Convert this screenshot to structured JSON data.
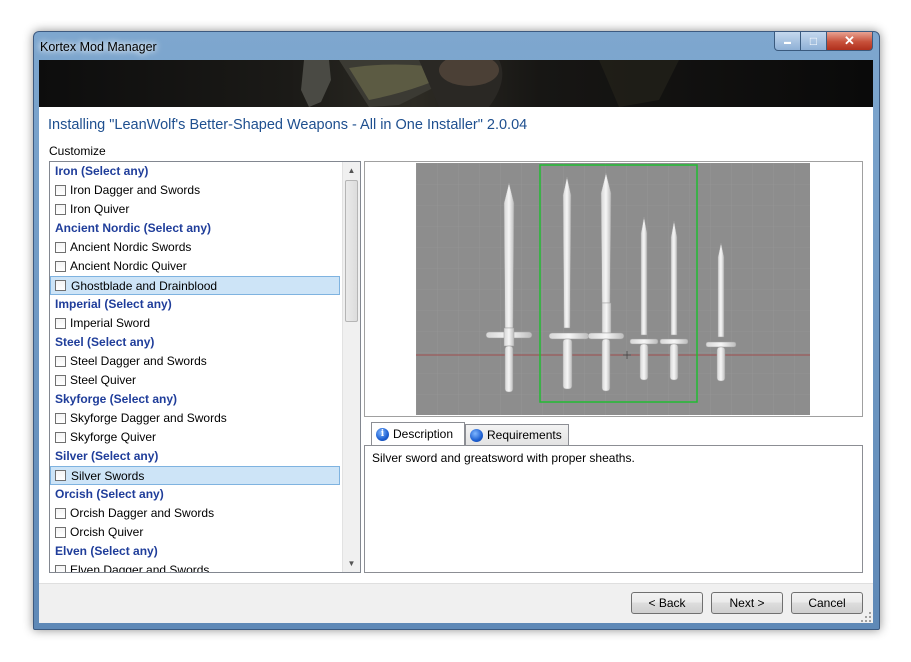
{
  "window": {
    "title": "Kortex Mod Manager",
    "minimize_glyph": "▬",
    "maximize_glyph": "□",
    "close_glyph": "✕"
  },
  "installer": {
    "title": "Installing \"LeanWolf's Better-Shaped Weapons - All in One Installer\" 2.0.04",
    "customize_label": "Customize"
  },
  "options": [
    {
      "type": "group",
      "label": "Iron (Select any)"
    },
    {
      "type": "option",
      "label": "Iron Dagger and Swords",
      "checked": false
    },
    {
      "type": "option",
      "label": "Iron Quiver",
      "checked": false
    },
    {
      "type": "group",
      "label": "Ancient Nordic (Select any)"
    },
    {
      "type": "option",
      "label": "Ancient Nordic Swords",
      "checked": false
    },
    {
      "type": "option",
      "label": "Ancient Nordic Quiver",
      "checked": false
    },
    {
      "type": "option",
      "label": "Ghostblade and Drainblood",
      "checked": false,
      "selected": true
    },
    {
      "type": "group",
      "label": "Imperial (Select any)"
    },
    {
      "type": "option",
      "label": "Imperial Sword",
      "checked": false
    },
    {
      "type": "group",
      "label": "Steel (Select any)"
    },
    {
      "type": "option",
      "label": "Steel Dagger and Swords",
      "checked": false
    },
    {
      "type": "option",
      "label": "Steel Quiver",
      "checked": false
    },
    {
      "type": "group",
      "label": "Skyforge (Select any)"
    },
    {
      "type": "option",
      "label": "Skyforge Dagger and Swords",
      "checked": false
    },
    {
      "type": "option",
      "label": "Skyforge Quiver",
      "checked": false
    },
    {
      "type": "group",
      "label": "Silver (Select any)"
    },
    {
      "type": "option",
      "label": "Silver Swords",
      "checked": false,
      "selected": true
    },
    {
      "type": "group",
      "label": "Orcish (Select any)"
    },
    {
      "type": "option",
      "label": "Orcish Dagger and Swords",
      "checked": false
    },
    {
      "type": "option",
      "label": "Orcish Quiver",
      "checked": false
    },
    {
      "type": "group",
      "label": "Elven (Select any)"
    },
    {
      "type": "option",
      "label": "Elven Dagger and Swords",
      "checked": false
    }
  ],
  "tabs": {
    "description_label": "Description",
    "description_icon": "i",
    "requirements_label": "Requirements"
  },
  "description": {
    "text": "Silver sword and greatsword with proper sheaths."
  },
  "buttons": {
    "back": "< Back",
    "next": "Next >",
    "cancel": "Cancel"
  },
  "colors": {
    "group_header": "#1f3d9a",
    "title_blue": "#1e4f8f",
    "selection": "#cde4f7",
    "preview_bg": "#8d8d8d",
    "highlight_box": "#22bb33"
  }
}
